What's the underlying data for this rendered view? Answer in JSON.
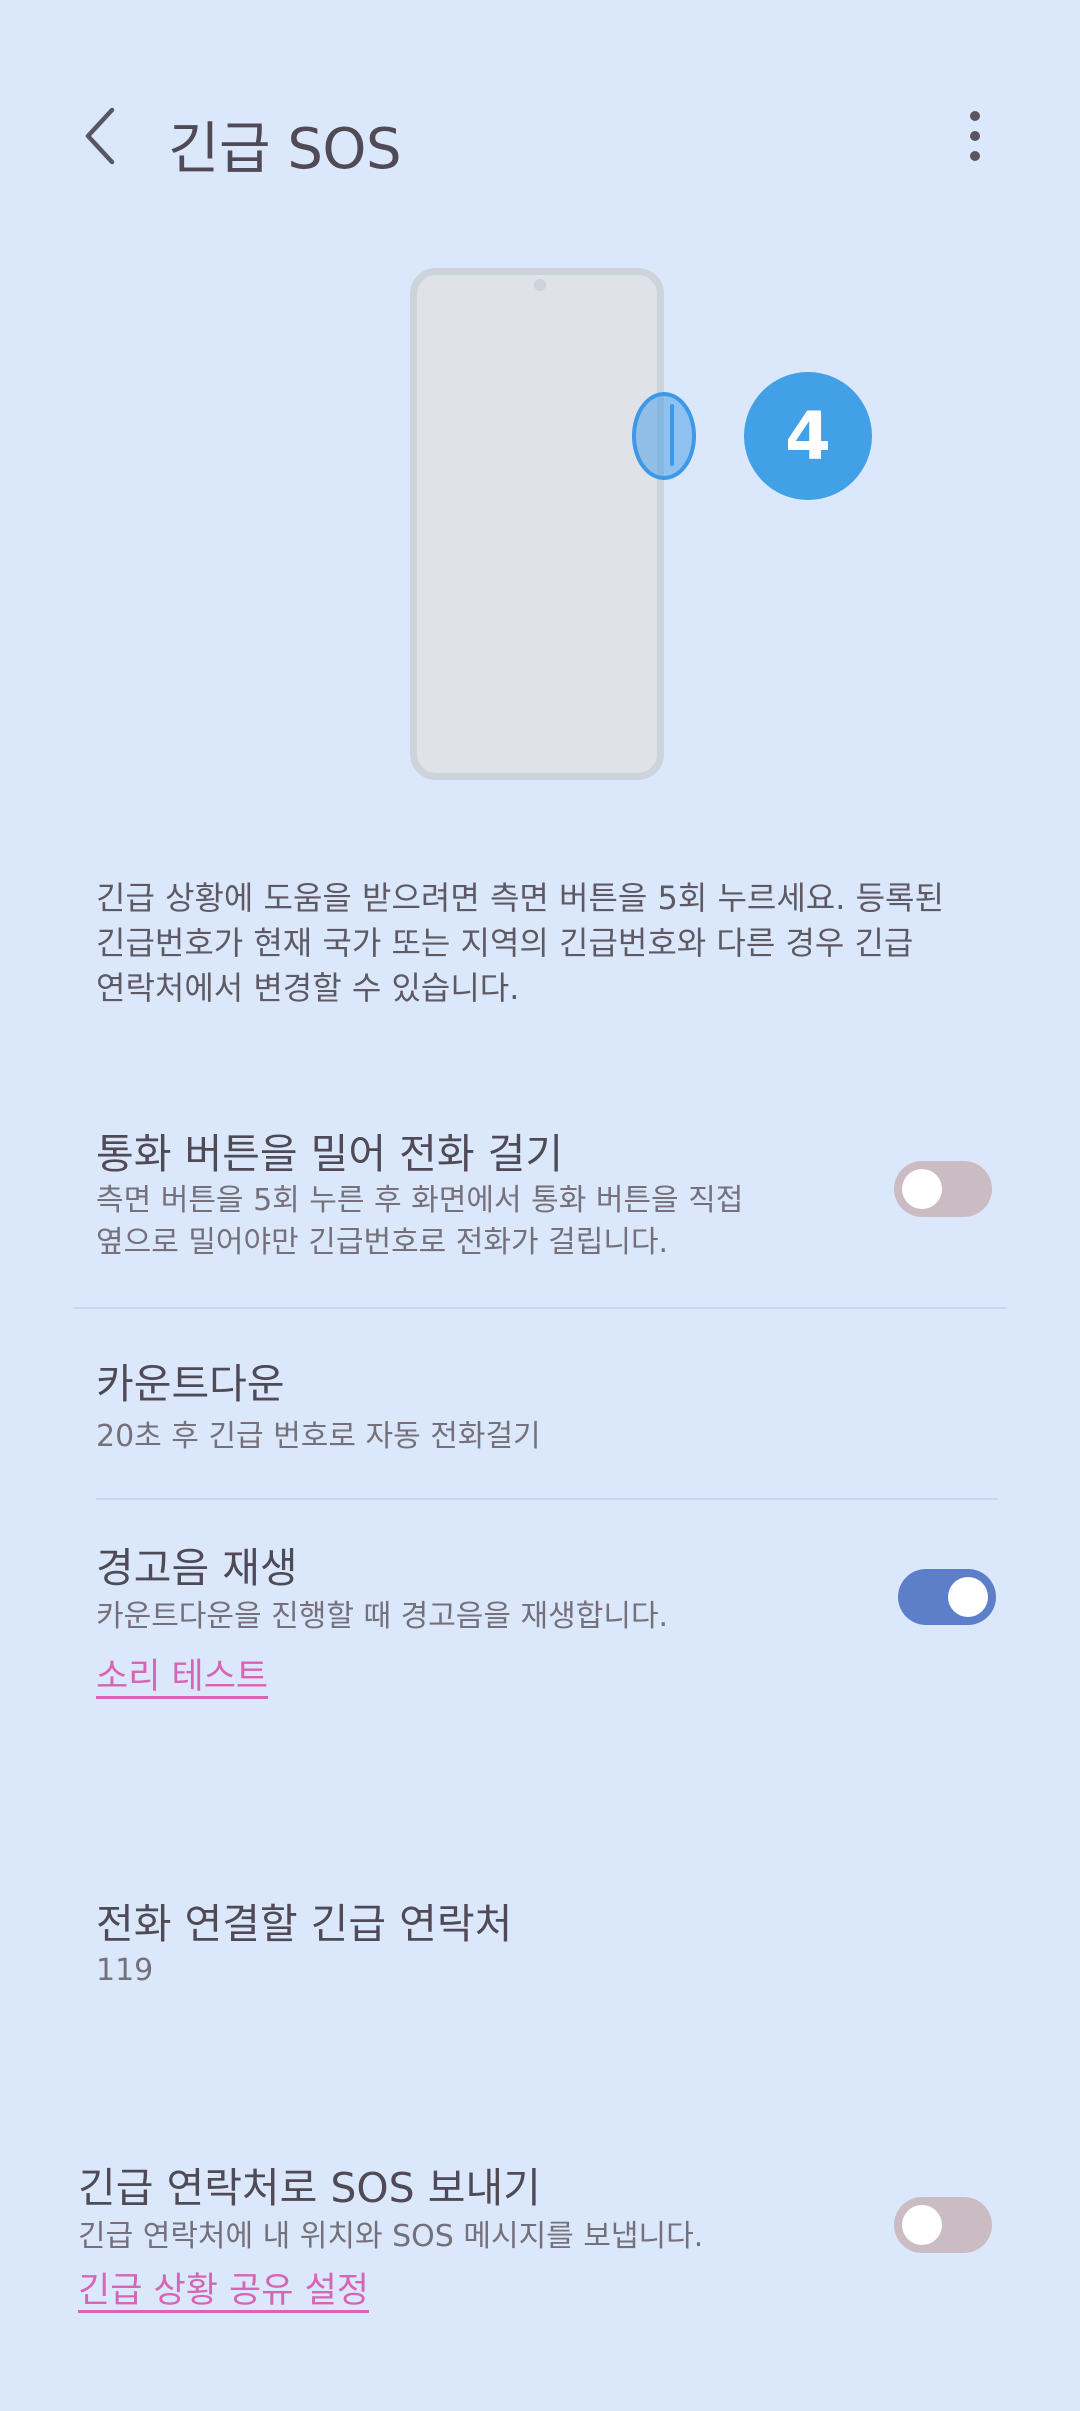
{
  "header": {
    "title": "긴급 SOS",
    "back_icon": "chevron-left-icon",
    "more_icon": "more-vertical-icon"
  },
  "illustration": {
    "press_count": "4"
  },
  "description": "긴급 상황에 도움을 받으려면 측면 버튼을 5회 누르세요. 등록된\n긴급번호가 현재 국가 또는 지역의 긴급번호와 다른 경우 긴급\n연락처에서 변경할 수 있습니다.",
  "settings": {
    "swipe_call": {
      "title": "통화 버튼을 밀어 전화 걸기",
      "subtitle": "측면 버튼을 5회 누른 후 화면에서 통화 버튼을 직접\n옆으로 밀어야만 긴급번호로 전화가 걸립니다.",
      "enabled": false
    },
    "countdown": {
      "title": "카운트다운",
      "subtitle": "20초 후 긴급 번호로 자동 전화걸기"
    },
    "alarm_sound": {
      "title": "경고음 재생",
      "subtitle": "카운트다운을 진행할 때 경고음을 재생합니다.",
      "link": "소리 테스트",
      "enabled": true
    },
    "emergency_number": {
      "title": "전화 연결할 긴급 연락처",
      "value": "119"
    },
    "send_sos": {
      "title": "긴급 연락처로 SOS 보내기",
      "subtitle": "긴급 연락처에 내 위치와 SOS 메시지를 보냅니다.",
      "link": "긴급 상황 공유 설정",
      "enabled": false
    }
  },
  "colors": {
    "background": "#dbe8fc",
    "toggle_on": "#5d7ec9",
    "toggle_off": "#cbbcc4",
    "link": "#d764b4",
    "badge": "#42a0e6"
  }
}
